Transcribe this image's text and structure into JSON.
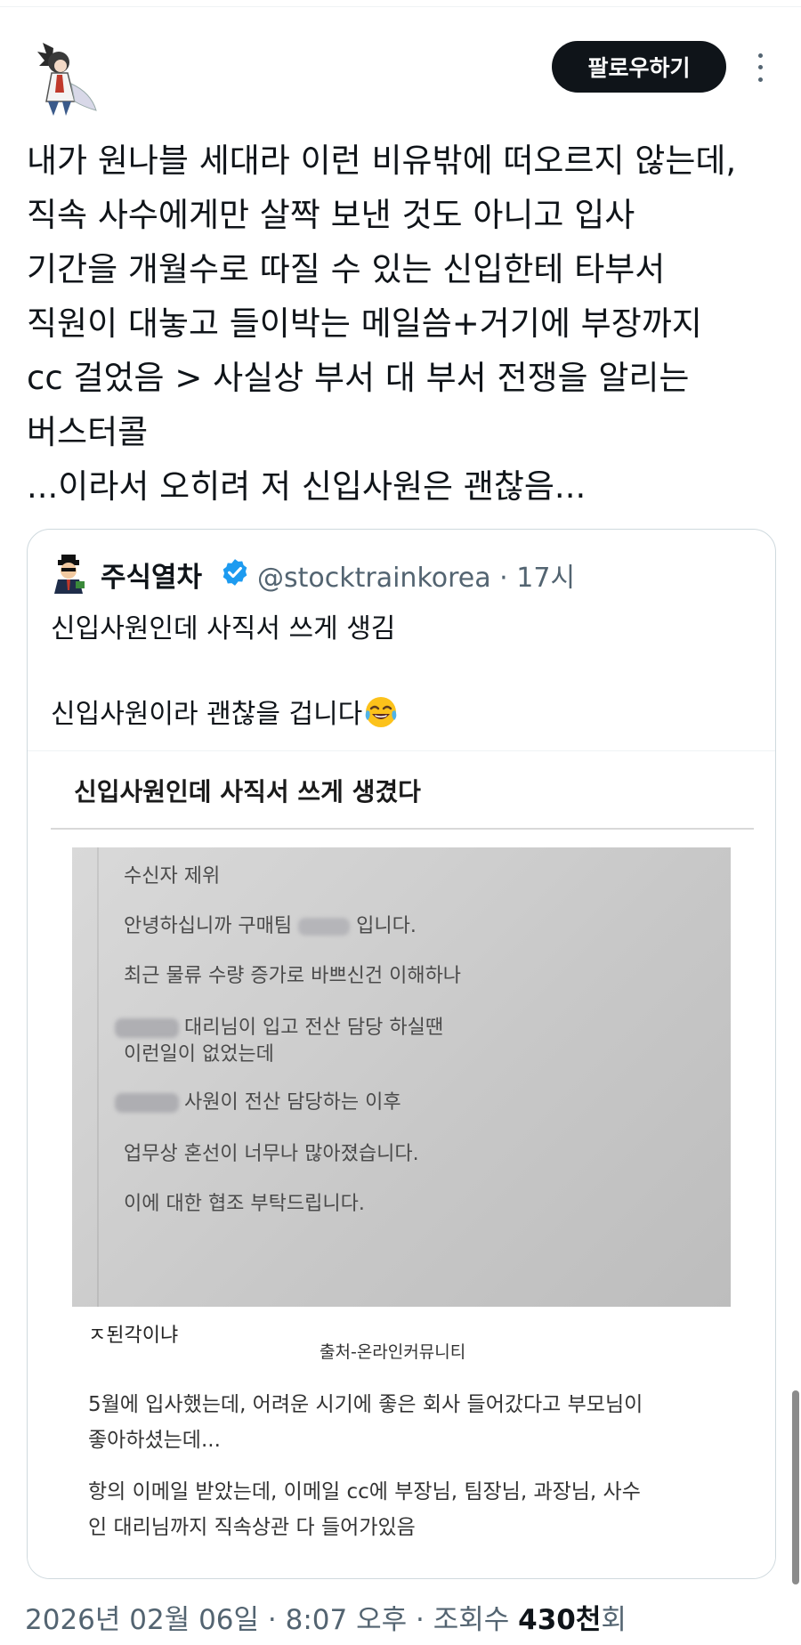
{
  "post": {
    "author_handle": "",
    "follow_label": "팔로우하기",
    "more_icon": "more-vertical-icon",
    "body_lines": [
      "내가 원나블 세대라 이런 비유밖에 떠오르지 않는데,",
      "직속 사수에게만 살짝 보낸 것도 아니고 입사",
      "기간을 개월수로 따질 수 있는 신입한테 타부서",
      "직원이 대놓고 들이박는 메일씀+거기에 부장까지",
      "cc 걸었음 > 사실상 부서 대 부서 전쟁을 알리는",
      "버스터콜",
      "...이라서 오히려 저 신입사원은 괜찮음..."
    ]
  },
  "quote": {
    "name": "주식열차",
    "verified_icon": "verified-badge-icon",
    "handle": "@stocktrainkorea",
    "separator": "·",
    "time": "17시",
    "text_lines": [
      "신입사원인데 사직서 쓰게 생김",
      "",
      "신입사원이라 괜찮을 겁니다"
    ],
    "emoji": "face-with-tears-of-joy",
    "image": {
      "title": "신입사원인데 사직서 쓰게 생겼다",
      "email_lines": [
        "수신자 제위",
        "안녕하십니까 구매팀",
        "입니다.",
        "최근 물류 수량 증가로 바쁘신건 이해하나",
        "대리님이 입고 전산 담당 하실땐",
        "이런일이 없었는데",
        "사원이 전산 담당하는 이후",
        "업무상 혼선이 너무나 많아졌습니다.",
        "이에 대한 협조 부탁드립니다."
      ],
      "caption_left": "ㅈ된각이냐",
      "caption_source": "출처-온라인커뮤니티",
      "paragraph1": [
        "5월에 입사했는데, 어려운 시기에 좋은 회사 들어갔다고 부모님이",
        "좋아하셨는데..."
      ],
      "paragraph2": [
        "항의 이메일 받았는데, 이메일 cc에 부장님, 팀장님, 과장님, 사수",
        "인 대리님까지 직속상관 다 들어가있음"
      ]
    }
  },
  "meta": {
    "date": "2026년 02월 06일",
    "dot": "·",
    "time": "8:07 오후",
    "views_label": "조회수",
    "views_count": "430천",
    "views_suffix": "회"
  },
  "colors": {
    "follow_bg": "#0f1419",
    "verified": "#1d9bf0",
    "muted": "#536471",
    "border": "#cfd9de"
  }
}
